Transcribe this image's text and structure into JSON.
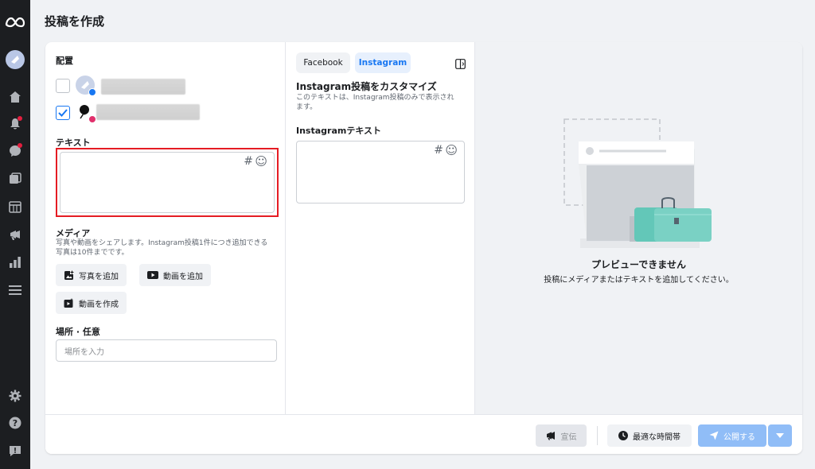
{
  "page": {
    "title": "投稿を作成"
  },
  "nav": {
    "icons": [
      "meta-logo-icon",
      "page-avatar-icon",
      "home-icon",
      "notifications-icon",
      "messages-icon",
      "content-icon",
      "planner-icon",
      "ads-icon",
      "insights-icon",
      "menu-icon",
      "settings-icon",
      "help-icon",
      "report-icon"
    ]
  },
  "placement": {
    "label": "配置",
    "accounts": [
      {
        "platform": "facebook",
        "checked": false
      },
      {
        "platform": "instagram",
        "checked": true
      }
    ]
  },
  "text_section": {
    "label": "テキスト",
    "hashtag_icon": "#",
    "emoji_icon": "☺"
  },
  "media": {
    "label": "メディア",
    "hint_line1": "写真や動画をシェアします。Instagram投稿1件につき追加できる",
    "hint_line2": "写真は10件までです。",
    "add_photo": "写真を追加",
    "add_video": "動画を追加",
    "create_video": "動画を作成"
  },
  "location": {
    "label": "場所 · 任意",
    "placeholder": "場所を入力"
  },
  "customize": {
    "tabs": [
      {
        "label": "Facebook",
        "active": false
      },
      {
        "label": "Instagram",
        "active": true
      }
    ],
    "title": "Instagram投稿をカスタマイズ",
    "desc_line1": "このテキストは、Instagram投稿のみで表示され",
    "desc_line2": "ます。",
    "field_label": "Instagramテキスト"
  },
  "preview": {
    "title": "プレビューできません",
    "subtitle": "投稿にメディアまたはテキストを追加してください。"
  },
  "footer": {
    "boost": "宣伝",
    "best_time": "最適な時間帯",
    "publish": "公開する"
  },
  "colors": {
    "accent": "#1877f2",
    "highlight_border": "#e51c23",
    "nav_bg": "#1c1e21",
    "instagram": "#e1306c"
  }
}
